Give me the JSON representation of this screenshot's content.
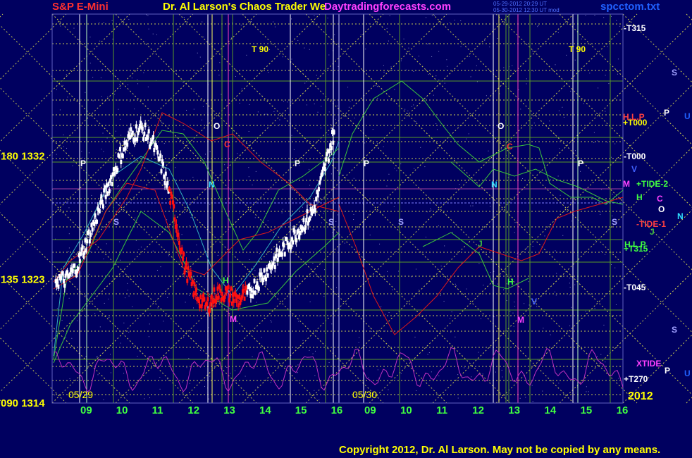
{
  "header": {
    "instrument": "S&P E-Mini",
    "title": "Dr. Al Larson's Chaos Trader We",
    "site": "Daytradingforecasts.com",
    "stamp_line1": "05-29-2012 20:29 UT",
    "stamp_line2": "05-30-2012 12:30 UT mod",
    "file": "spcctom.txt"
  },
  "footer": {
    "copyright": "Copyright 2012, Dr. Al Larson. May not be copied by any means."
  },
  "colors": {
    "background": "#000060",
    "grid_yellow": "#c8c850",
    "grid_green": "#5a9a28",
    "price_white": "#ffffff",
    "price_red": "#ff1010",
    "band_green": "#3cc43c",
    "band_red": "#e01818",
    "cyan": "#30b0c0",
    "xtide_magenta": "#c030c0",
    "marker_magenta": "#ff50c0"
  },
  "chart_data": {
    "type": "line",
    "title": "S&P E-Mini",
    "ylabel": "",
    "xlabel": "",
    "ylim": [
      1314,
      1335
    ],
    "y_ticks": [
      {
        "label": "090  1314",
        "value": 1314
      },
      {
        "label": "135  1323",
        "value": 1323
      },
      {
        "label": "180  1332",
        "value": 1332
      }
    ],
    "x_ticks_day1": [
      "09",
      "10",
      "11",
      "12",
      "13",
      "14",
      "15",
      "16"
    ],
    "x_ticks_day2": [
      "09",
      "10",
      "11",
      "12",
      "13",
      "14",
      "15",
      "16"
    ],
    "date_labels": [
      "05/29",
      "05/30"
    ],
    "year_label": "2012",
    "price_series": {
      "name": "S&P E-Mini",
      "x_hours": [
        8.2,
        8.5,
        8.8,
        9.1,
        9.4,
        9.7,
        10.0,
        10.3,
        10.6,
        10.9,
        11.2,
        11.5,
        11.8,
        12.1,
        12.4,
        12.7,
        13.0,
        13.3,
        13.6,
        13.9,
        14.2,
        14.5,
        14.8,
        15.1,
        15.4,
        15.7,
        16.0
      ],
      "close": [
        1323,
        1323,
        1324,
        1326,
        1328,
        1330,
        1332,
        1333.5,
        1334,
        1333,
        1331,
        1328,
        1324,
        1322,
        1321,
        1322,
        1322,
        1321.5,
        1322,
        1323,
        1324,
        1325,
        1326,
        1327,
        1328,
        1331,
        1334
      ]
    },
    "forecast_labels": [
      {
        "text": "-T315"
      },
      {
        "text": "+T000"
      },
      {
        "text": "-T000"
      },
      {
        "text": "+TIDE-2"
      },
      {
        "text": "-TIDE-1"
      },
      {
        "text": "+T315"
      },
      {
        "text": "-T045"
      },
      {
        "text": "+T270"
      },
      {
        "text": "XTIDE"
      },
      {
        "text": "H.L.P"
      },
      {
        "text": "H.L.P"
      }
    ],
    "planet_markers": [
      "P",
      "S",
      "O",
      "C",
      "N",
      "H",
      "M",
      "V",
      "J",
      "T",
      "U"
    ],
    "t90_labels": [
      "T  90",
      "T  90"
    ]
  }
}
